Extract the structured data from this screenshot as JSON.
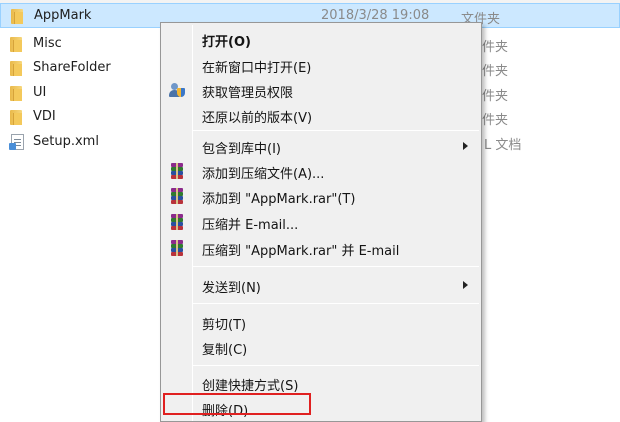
{
  "files": [
    {
      "name": "AppMark",
      "date": "2018/3/28 19:08",
      "type": "文件夹",
      "icon": "folder-icon",
      "selected": true
    },
    {
      "name": "Misc",
      "date": "",
      "type": "件夹",
      "icon": "folder-icon"
    },
    {
      "name": "ShareFolder",
      "date": "",
      "type": "件夹",
      "icon": "folder-icon"
    },
    {
      "name": "UI",
      "date": "",
      "type": "件夹",
      "icon": "folder-icon"
    },
    {
      "name": "VDI",
      "date": "",
      "type": "件夹",
      "icon": "folder-icon"
    },
    {
      "name": "Setup.xml",
      "date": "",
      "type": "L 文档",
      "icon": "xml-file-icon"
    }
  ],
  "context_menu": {
    "open": "打开(O)",
    "open_new_window": "在新窗口中打开(E)",
    "take_ownership": "获取管理员权限",
    "restore_previous": "还原以前的版本(V)",
    "include_in_library": "包含到库中(I)",
    "add_to_archive": "添加到压缩文件(A)...",
    "add_to_rar": "添加到 \"AppMark.rar\"(T)",
    "compress_email": "压缩并 E-mail...",
    "compress_rar_email": "压缩到 \"AppMark.rar\" 并 E-mail",
    "send_to": "发送到(N)",
    "cut": "剪切(T)",
    "copy": "复制(C)",
    "create_shortcut": "创建快捷方式(S)",
    "delete": "删除(D)"
  },
  "colors": {
    "selection": "#cce8ff",
    "menu_background": "#f0f0f0",
    "highlight_border": "#e02020"
  }
}
